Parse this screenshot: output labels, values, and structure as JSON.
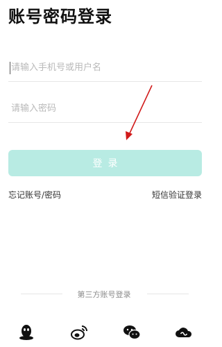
{
  "header": {
    "title": "账号密码登录"
  },
  "form": {
    "username_placeholder": "请输入手机号或用户名",
    "password_placeholder": "请输入密码",
    "login_label": "登录"
  },
  "links": {
    "forgot": "忘记账号/密码",
    "sms_login": "短信验证登录"
  },
  "third_party": {
    "label": "第三方账号登录",
    "icons": [
      "qq-icon",
      "weibo-icon",
      "wechat-icon",
      "cloud-icon"
    ]
  },
  "colors": {
    "button_bg": "#b8ebe3",
    "annotation_arrow": "#d11a1a"
  }
}
